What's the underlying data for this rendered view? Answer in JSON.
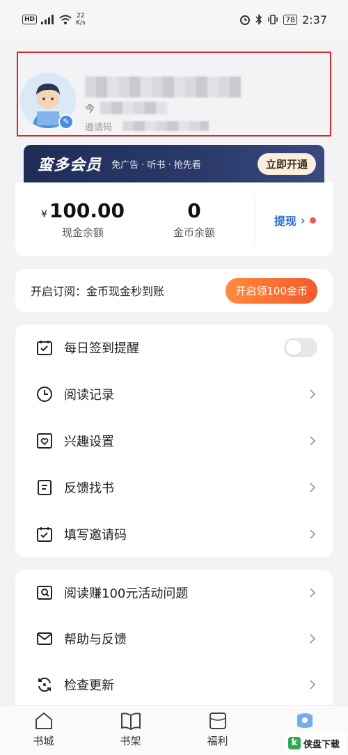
{
  "status_bar": {
    "hd": "HD",
    "net_speed_value": "22",
    "net_speed_unit": "K/s",
    "battery": "78",
    "time": "2:37"
  },
  "profile": {
    "today_prefix": "今",
    "invite_prefix": "邀请码"
  },
  "vip": {
    "title": "蛮多会员",
    "desc": "免广告 · 听书 · 抢先看",
    "button": "立即开通"
  },
  "wallet": {
    "cash_currency": "¥",
    "cash_value": "100.00",
    "cash_label": "现金余额",
    "coin_value": "0",
    "coin_label": "金币余额",
    "withdraw_label": "提现",
    "withdraw_chevron": "›"
  },
  "subscribe": {
    "text": "开启订阅：金币现金秒到账",
    "button": "开启领100金币"
  },
  "menu1": [
    {
      "label": "每日签到提醒",
      "icon": "calendar-check-icon",
      "control": "toggle",
      "toggle_on": false
    },
    {
      "label": "阅读记录",
      "icon": "clock-icon",
      "control": "chevron"
    },
    {
      "label": "兴趣设置",
      "icon": "heart-box-icon",
      "control": "chevron"
    },
    {
      "label": "反馈找书",
      "icon": "document-icon",
      "control": "chevron"
    },
    {
      "label": "填写邀请码",
      "icon": "calendar-check-icon",
      "control": "chevron"
    }
  ],
  "menu2": [
    {
      "label": "阅读赚100元活动问题",
      "icon": "search-box-icon",
      "control": "chevron"
    },
    {
      "label": "帮助与反馈",
      "icon": "mail-icon",
      "control": "chevron"
    },
    {
      "label": "检查更新",
      "icon": "refresh-icon",
      "control": "chevron"
    }
  ],
  "bottom_nav": [
    {
      "label": "书城",
      "icon": "house-icon"
    },
    {
      "label": "书架",
      "icon": "book-icon"
    },
    {
      "label": "福利",
      "icon": "gift-box-icon"
    },
    {
      "label": "",
      "icon": "profile-icon",
      "active": true
    }
  ],
  "watermark": {
    "logo": "k",
    "text": "侠盘下载"
  },
  "colors": {
    "accent_blue": "#2f6fc9",
    "highlight_red": "#d62a2a",
    "orange": "#f45b2a",
    "vip_navy": "#1f2d56"
  }
}
